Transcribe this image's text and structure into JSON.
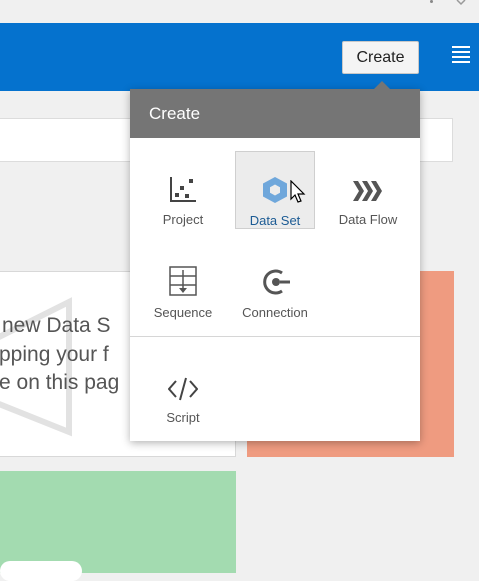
{
  "header": {
    "create_label": "Create"
  },
  "background_card": {
    "lines": [
      "new Data S",
      "pping your f",
      "e on this pag"
    ]
  },
  "popup": {
    "title": "Create",
    "items": [
      {
        "label": "Project",
        "icon": "scatter-plot-icon"
      },
      {
        "label": "Data Set",
        "icon": "hexagon-icon"
      },
      {
        "label": "Data Flow",
        "icon": "chevrons-right-icon"
      },
      {
        "label": "Sequence",
        "icon": "sequence-icon"
      },
      {
        "label": "Connection",
        "icon": "plug-icon"
      },
      {
        "label": "Script",
        "icon": "code-icon"
      }
    ]
  },
  "colors": {
    "header": "#0572ce",
    "popup_header": "#757575",
    "accent_icon": "#6fa7db",
    "card_orange": "#ef9b80",
    "card_green": "#a3dbb0"
  }
}
